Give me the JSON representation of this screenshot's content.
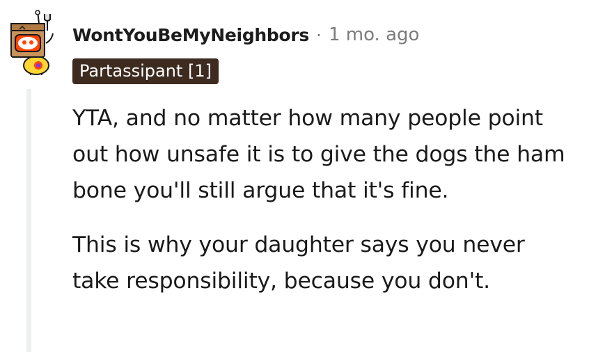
{
  "comment": {
    "username": "WontYouBeMyNeighbors",
    "separator": "·",
    "timestamp": "1 mo. ago",
    "flair": "Partassipant [1]",
    "paragraphs": [
      "YTA, and no matter how many people point out how unsafe it is to give the dogs the ham bone you'll still argue that it's fine.",
      "This is why your daughter says you never take responsibility, because you don't."
    ],
    "avatar_icon": "snoo-box-head-avatar",
    "colors": {
      "flair_bg": "#3d2b20",
      "flair_text": "#ffffff",
      "meta_gray": "#7c7c7c",
      "thread_line": "#edeff1"
    }
  }
}
